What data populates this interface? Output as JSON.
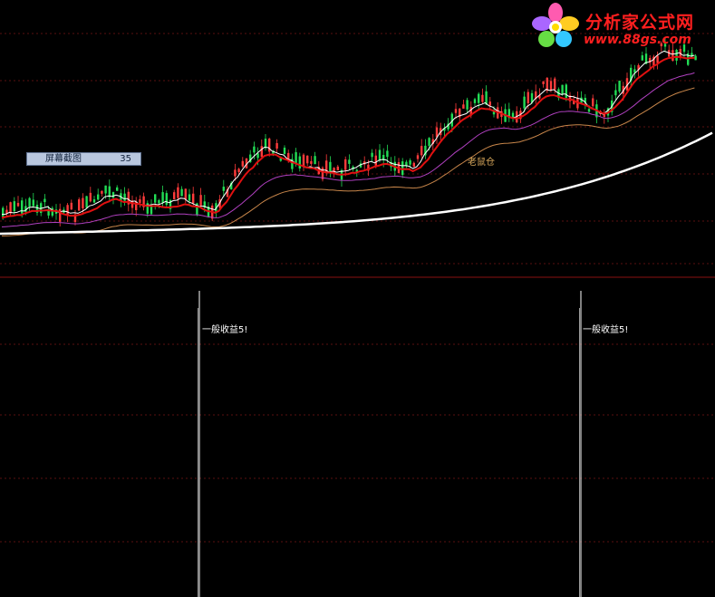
{
  "logo": {
    "brand": "分析家公式网",
    "url": "www.88gs.com",
    "icon": "flower-icon"
  },
  "tooltip": {
    "label": "屏幕截图",
    "value": "35"
  },
  "annotations": {
    "mouse_warehouse": "老鼠仓"
  },
  "signals": {
    "label": "一般收益5!",
    "count": 2
  },
  "colors": {
    "background": "#000000",
    "candle_up": "#ff3b3b",
    "candle_down": "#22dd55",
    "ma_white": "#ffffff",
    "ma_red": "#e01010",
    "ma_magenta": "#b040c0",
    "ma_orange": "#c8864a",
    "long_ma": "#ffffff",
    "separator": "#8a1010",
    "grid": "#5a1010"
  }
}
